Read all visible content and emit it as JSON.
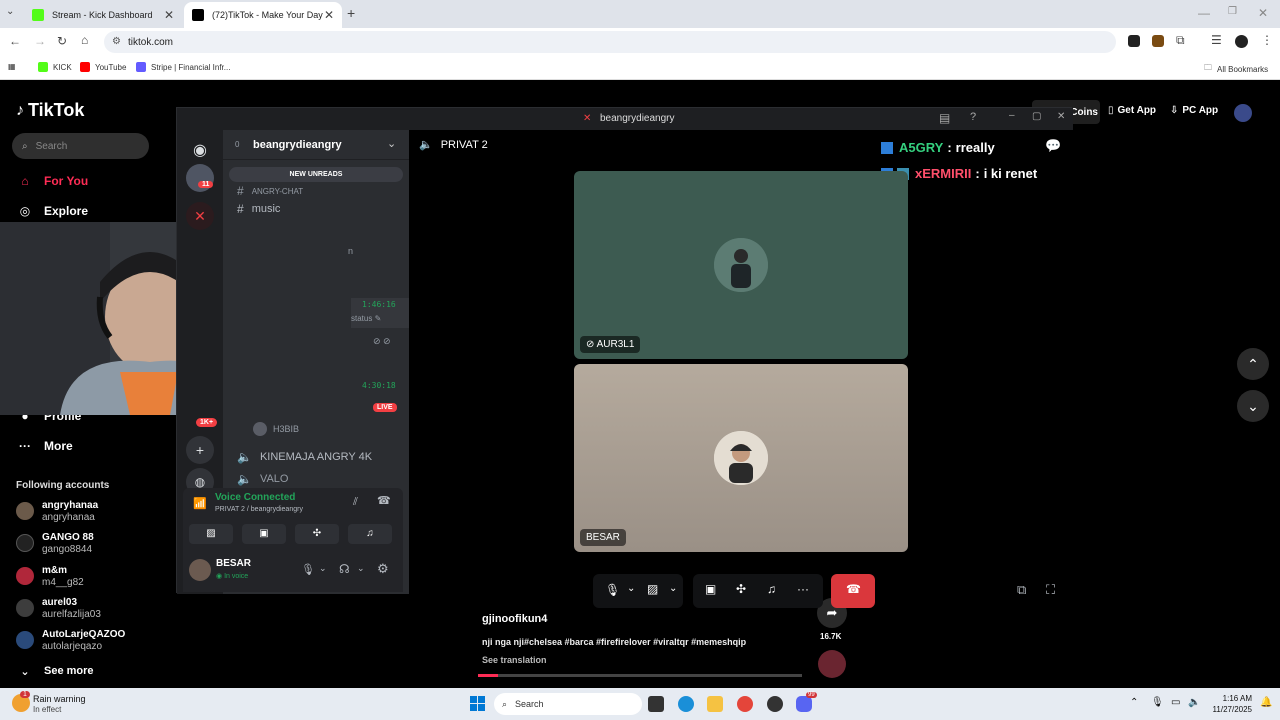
{
  "browser": {
    "tabs": [
      {
        "label": "Stream - Kick Dashboard",
        "color": "#53fc18"
      },
      {
        "label": "(72)TikTok - Make Your Day",
        "color": "#000000"
      }
    ],
    "url": "tiktok.com",
    "bookmarks": [
      {
        "label": "KICK",
        "color": "#53fc18"
      },
      {
        "label": "YouTube",
        "color": "#ff0000"
      },
      {
        "label": "Stripe | Financial Infr...",
        "color": "#635bff"
      }
    ],
    "all_bookmarks": "All Bookmarks"
  },
  "tiktok": {
    "logo": "TikTok",
    "search_placeholder": "Search",
    "nav": [
      {
        "label": "For You",
        "icon": "home-icon",
        "active": true
      },
      {
        "label": "Explore",
        "icon": "compass-icon",
        "active": false
      }
    ],
    "nav_bottom": [
      {
        "label": "Profile",
        "icon": "profile-icon"
      },
      {
        "label": "More",
        "icon": "more-icon"
      }
    ],
    "following_title": "Following accounts",
    "accounts": [
      {
        "name": "angryhanaa",
        "handle": "angryhanaa"
      },
      {
        "name": "GANGO 88",
        "handle": "gango8844"
      },
      {
        "name": "m&m",
        "handle": "m4__g82"
      },
      {
        "name": "aurel03",
        "handle": "aurelfazlija03"
      },
      {
        "name": "AutoLarjeQAZOO",
        "handle": "autolarjeqazo"
      }
    ],
    "see_more": "See more",
    "header": {
      "coins": "Coins",
      "get_app": "Get App",
      "pc_app": "PC App"
    },
    "video": {
      "author": "gjinoofikun4",
      "caption": "nji nga nji#chelsea #barca #firefirelover #viraltqr #memeshqip",
      "see_translation": "See translation",
      "share_count": "16.7K"
    }
  },
  "discord": {
    "window_title": "beangrydieangry",
    "server_name": "beangrydieangry",
    "new_unreads": "NEW UNREADS",
    "channels": {
      "angry_chat": "ANGRY-CHAT",
      "music": "music",
      "h3bib": "H3BIB",
      "kinemaja": "KINEMAJA ANGRY 4K",
      "valo": "VALO"
    },
    "partial_n": "n",
    "time1": "1:46:16",
    "status": "status",
    "time2": "4:30:18",
    "live": "LIVE",
    "badge_11": "11",
    "badge_1k": "1K+",
    "voice_connected": "Voice Connected",
    "voice_channel": "PRIVAT 2 / beangrydieangry",
    "user_name": "BESAR",
    "user_status": "In voice",
    "call_channel": "PRIVAT 2",
    "participants": [
      {
        "name": "AUR3L1",
        "bg": "#3d5b51"
      },
      {
        "name": "BESAR",
        "bg": "#b2a79a"
      }
    ],
    "chat_overlay": [
      {
        "user": "A5GRY",
        "msg": "rreally",
        "color": "#35d07f"
      },
      {
        "user": "xERMIRII",
        "msg": "i ki renet",
        "color": "#ff4f6b"
      }
    ]
  },
  "taskbar": {
    "weather_title": "Rain warning",
    "weather_sub": "In effect",
    "weather_badge": "1",
    "search": "Search",
    "time": "1:16 AM",
    "date": "11/27/2025",
    "discord_badge": "99"
  }
}
